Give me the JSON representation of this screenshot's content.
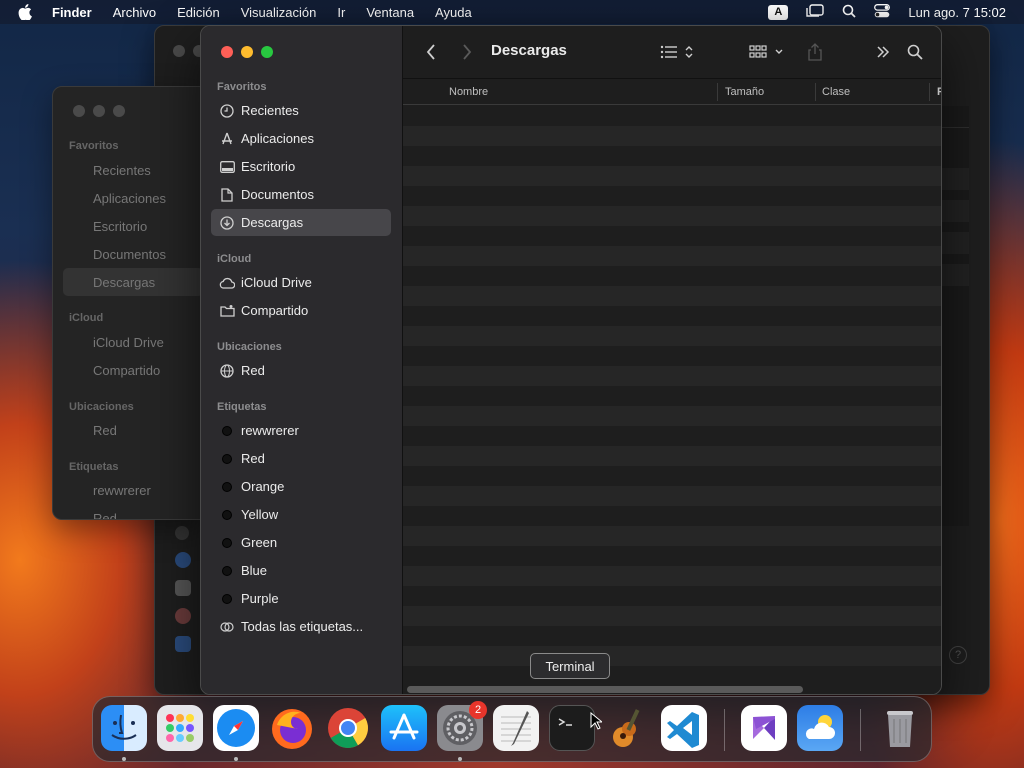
{
  "menubar": {
    "app_name": "Finder",
    "menus": [
      "Archivo",
      "Edición",
      "Visualización",
      "Ir",
      "Ventana",
      "Ayuda"
    ],
    "input_source": "A",
    "clock": "Lun ago. 7  15:02"
  },
  "back_window": {
    "sections": {
      "favorites": "Favoritos",
      "icloud": "iCloud",
      "locations": "Ubicaciones",
      "tags": "Etiquetas"
    },
    "items": [
      "Recientes",
      "Aplicaciones",
      "Escritorio",
      "Documentos",
      "Descargas",
      "iCloud Drive",
      "Compartido",
      "Red",
      "rewwrerer",
      "Red"
    ]
  },
  "finder": {
    "title": "Descargas",
    "sidebar": {
      "favorites_header": "Favoritos",
      "favorites": [
        {
          "label": "Recientes",
          "icon": "clock-icon"
        },
        {
          "label": "Aplicaciones",
          "icon": "apps-icon"
        },
        {
          "label": "Escritorio",
          "icon": "desktop-icon"
        },
        {
          "label": "Documentos",
          "icon": "document-icon"
        },
        {
          "label": "Descargas",
          "icon": "download-icon",
          "selected": true
        }
      ],
      "icloud_header": "iCloud",
      "icloud": [
        {
          "label": "iCloud Drive",
          "icon": "cloud-icon"
        },
        {
          "label": "Compartido",
          "icon": "shared-folder-icon"
        }
      ],
      "locations_header": "Ubicaciones",
      "locations": [
        {
          "label": "Red",
          "icon": "network-icon"
        }
      ],
      "tags_header": "Etiquetas",
      "tags": [
        "rewwrerer",
        "Red",
        "Orange",
        "Yellow",
        "Green",
        "Blue",
        "Purple"
      ],
      "all_tags": "Todas las etiquetas..."
    },
    "columns": {
      "name": "Nombre",
      "size": "Tamaño",
      "kind": "Clase",
      "truncated": "F"
    }
  },
  "tooltip": "Terminal",
  "dock": {
    "apps": [
      "Finder",
      "Launchpad",
      "Safari",
      "Firefox",
      "Chrome",
      "App Store",
      "System Settings",
      "TextEdit",
      "Terminal",
      "GarageBand",
      "Visual Studio Code",
      "Visual Studio",
      "Weather",
      "Trash"
    ],
    "settings_badge": "2"
  },
  "colors": {
    "accent_red": "#fe5f57",
    "accent_yellow": "#febc2e",
    "accent_green": "#28c840",
    "badge": "#e8352b"
  }
}
